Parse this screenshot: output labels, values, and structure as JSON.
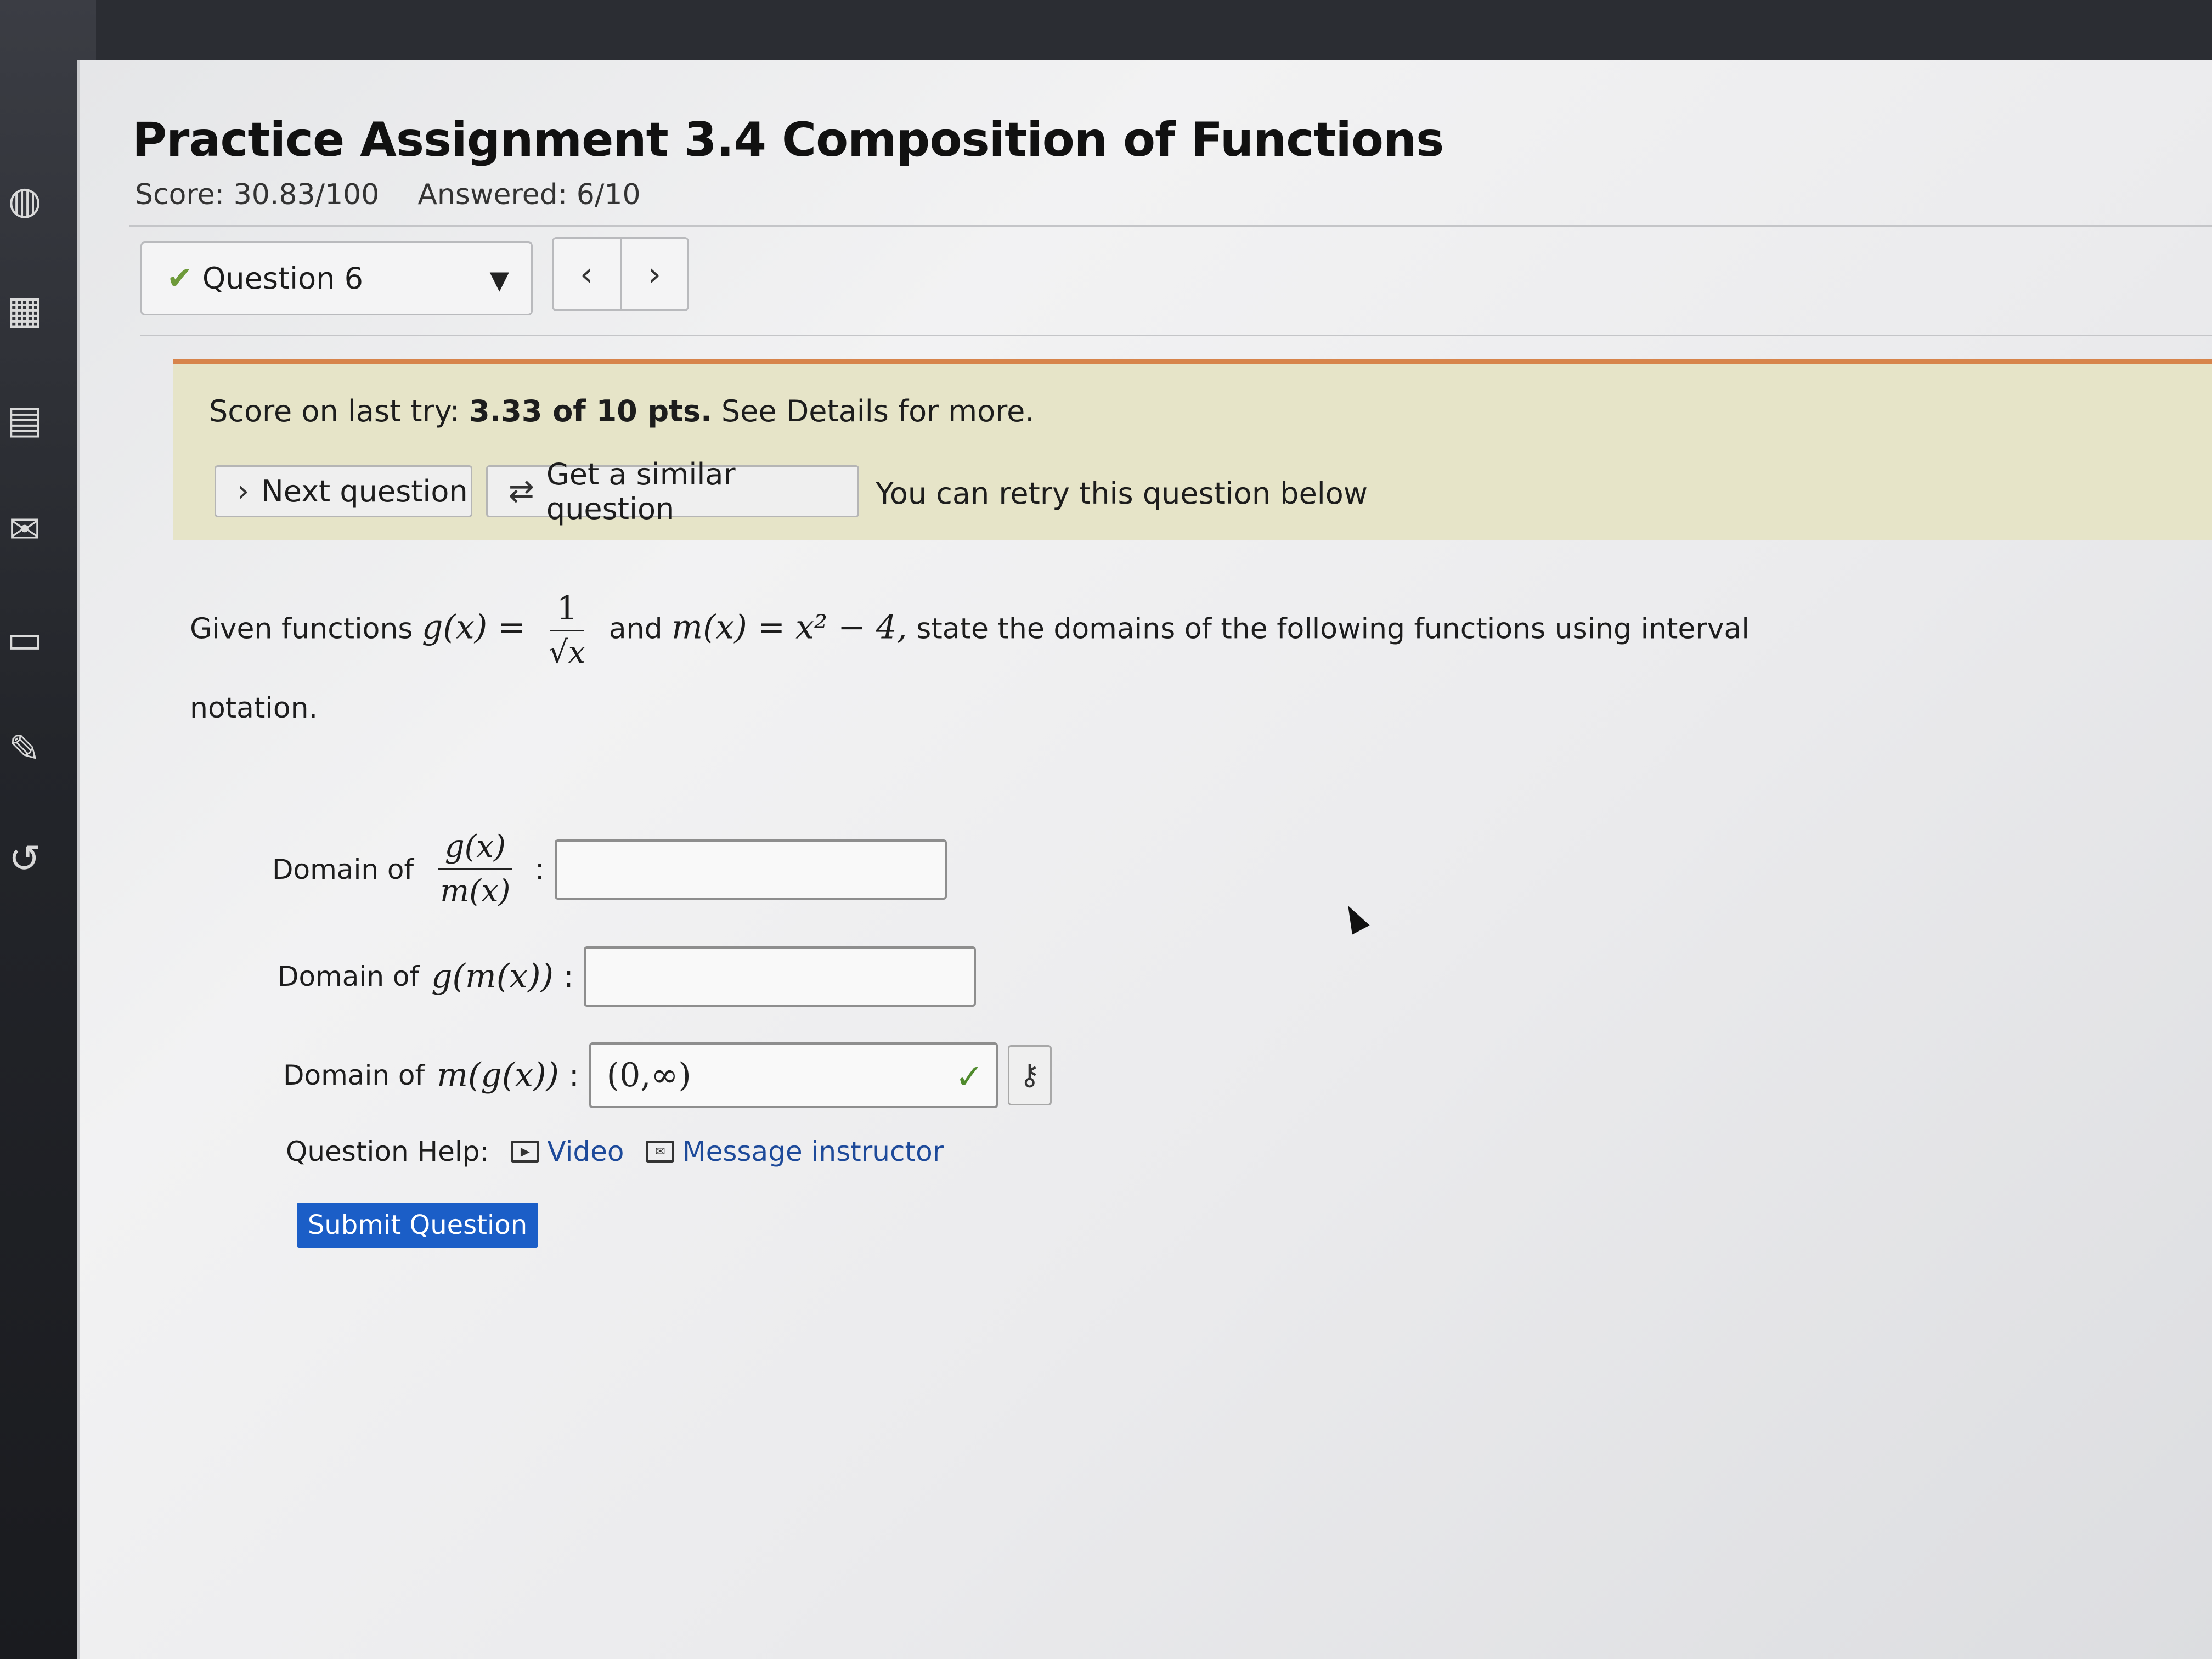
{
  "assignment": {
    "title": "Practice Assignment 3.4 Composition of Functions",
    "score": "Score: 30.83/100",
    "answered": "Answered: 6/10"
  },
  "question_nav": {
    "selected": "Question 6",
    "status_icon": "checkmark-icon",
    "prev_icon": "chevron-left-icon",
    "next_icon": "chevron-right-icon"
  },
  "feedback": {
    "prefix": "Score on last try: ",
    "points": "3.33 of 10 pts.",
    "suffix": " See Details for more.",
    "next_question_label": "Next question",
    "similar_question_label": "Get a similar question",
    "retry_text": "You can retry this question below",
    "accent_color": "#d7844b",
    "background_color": "#e6e4c8"
  },
  "question": {
    "intro": "Given functions",
    "g_def_left": "g(x) =",
    "g_num": "1",
    "g_den": "√x",
    "and": "and",
    "m_def": "m(x) = x² − 4,",
    "rest": "state the domains of the following functions using interval",
    "notation": "notation."
  },
  "domains": [
    {
      "label": "Domain of",
      "num": "g(x)",
      "den": "m(x)",
      "value": ""
    },
    {
      "label": "Domain of",
      "expr": "g(m(x))",
      "value": ""
    },
    {
      "label": "Domain of",
      "expr": "m(g(x))",
      "value": "(0,∞)",
      "status": "correct"
    }
  ],
  "help": {
    "label": "Question Help:",
    "video": "Video",
    "message": "Message instructor"
  },
  "submit_label": "Submit Question",
  "submit_color": "#1b5ec7"
}
